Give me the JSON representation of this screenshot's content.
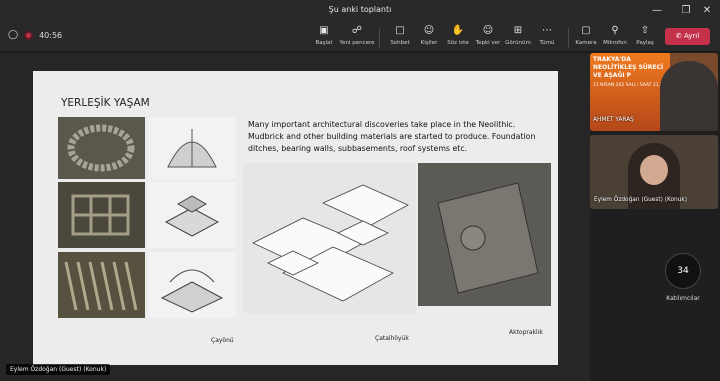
{
  "window": {
    "title": "Şu anki toplantı",
    "min_icon": "minimize-icon",
    "max_icon": "maximize-icon",
    "close_icon": "close-icon"
  },
  "meeting": {
    "timer": "40:56"
  },
  "toolbar": [
    {
      "key": "start",
      "label": "Başlat",
      "icon": "start-icon"
    },
    {
      "key": "newwin",
      "label": "Yeni pencere",
      "icon": "new-window-icon"
    },
    {
      "key": "chat",
      "label": "Sohbet",
      "icon": "chat-icon"
    },
    {
      "key": "people",
      "label": "Kişiler",
      "icon": "people-icon"
    },
    {
      "key": "raise",
      "label": "Söz iste",
      "icon": "raise-hand-icon"
    },
    {
      "key": "react",
      "label": "Tepki ver",
      "icon": "reaction-icon"
    },
    {
      "key": "view",
      "label": "Görünüm",
      "icon": "view-icon"
    },
    {
      "key": "more",
      "label": "Tümü",
      "icon": "more-icon"
    },
    {
      "key": "camera",
      "label": "Kamera",
      "icon": "camera-icon"
    },
    {
      "key": "mic",
      "label": "Mikrofon",
      "icon": "microphone-icon"
    },
    {
      "key": "share",
      "label": "Paylaş",
      "icon": "share-icon"
    }
  ],
  "leave_button": {
    "label": "Ayrıl",
    "color": "#c4314b"
  },
  "slide": {
    "title": "YERLEŞİK YAŞAM",
    "text": "Many important architectural discoveries take place in the Neolithic. Mudbrick and other building materials are started to produce. Foundation ditches, bearing walls, subbasements, roof systems etc.",
    "captions": {
      "cayonu": "Çayönü",
      "catalhoyuk": "Çatalhöyük",
      "aktopraklik": "Aktopraklık"
    }
  },
  "presenter_tag": "Eylem Özdoğan (Guest) (Konuk)",
  "participants": [
    {
      "name": "AHMET YARAŞ",
      "poster_text": "TRAKYA'DA NEOLİTİKLEŞ SÜRECİ VE AŞAĞI P",
      "poster_date": "11 NİSAN 202 SALI / SAAT 21.0"
    },
    {
      "name": "Eylem Özdoğan (Guest) (Konuk)"
    }
  ],
  "participant_count": {
    "value": "34",
    "label": "Katılımcılar"
  }
}
